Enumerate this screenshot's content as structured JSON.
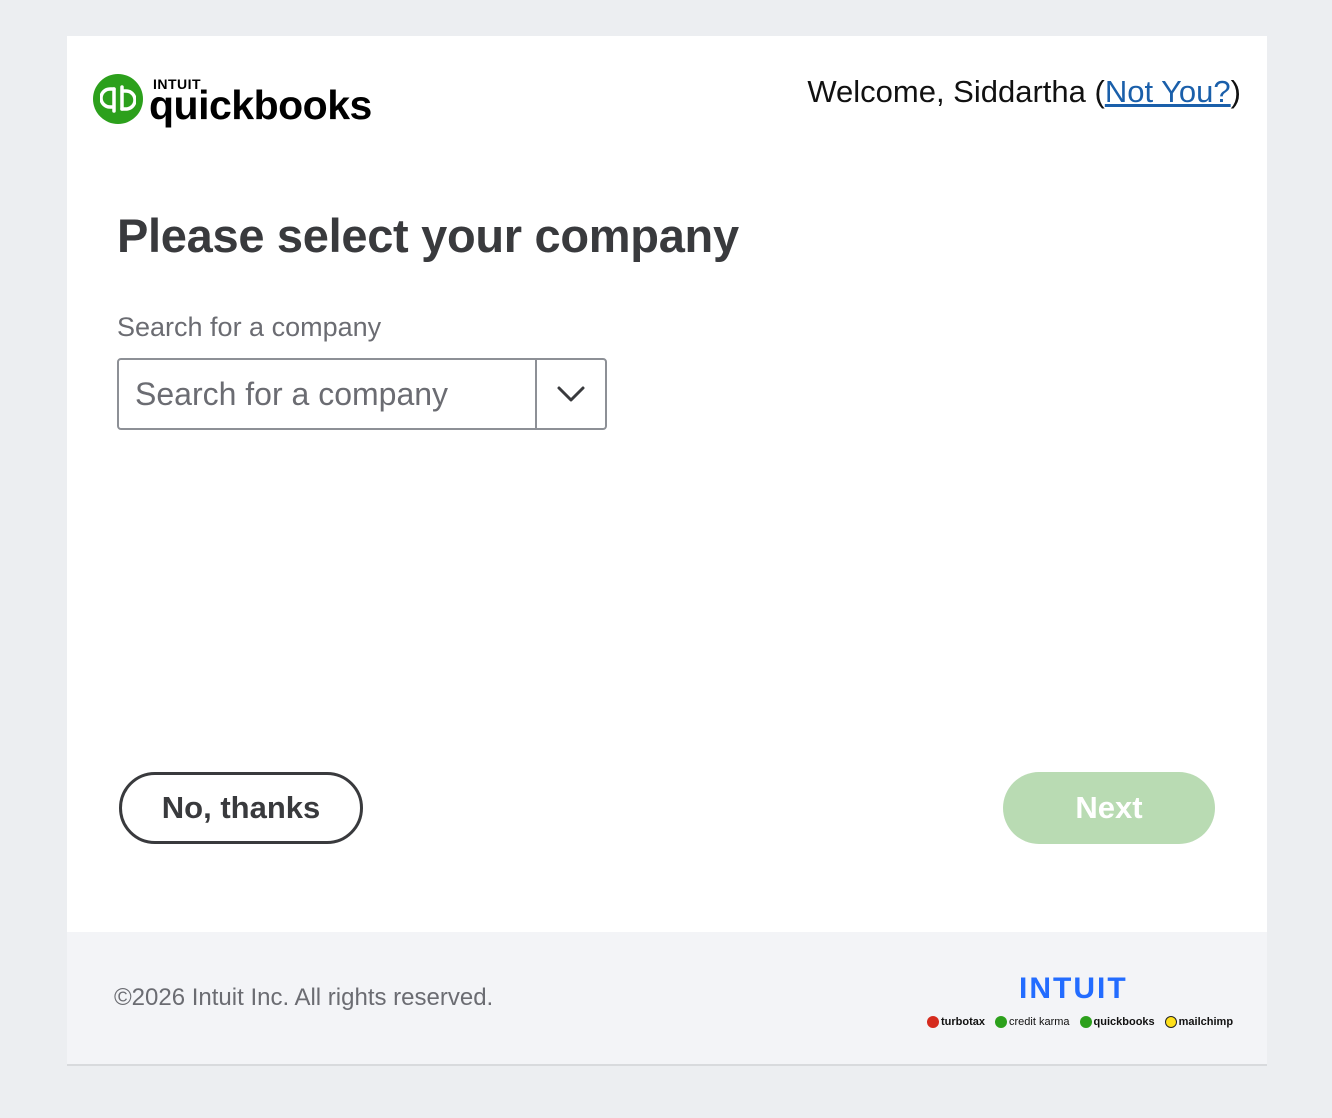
{
  "header": {
    "logo_small": "INTUIT",
    "logo_word": "quickbooks",
    "welcome_prefix": "Welcome, Siddartha (",
    "not_you_link": "Not You?",
    "welcome_suffix": ")"
  },
  "main": {
    "title": "Please select your company",
    "search_label": "Search for a company",
    "search_placeholder": "Search for a company",
    "search_value": ""
  },
  "actions": {
    "cancel_label": "No, thanks",
    "next_label": "Next"
  },
  "footer": {
    "copyright": "©2026 Intuit Inc. All rights reserved.",
    "brand": "INTUIT",
    "family": [
      {
        "label": "turbotax",
        "icon": "turbotax-icon",
        "color": "#d52b1e"
      },
      {
        "label": "credit karma",
        "icon": "credit-karma-icon",
        "color": "#2ca01c"
      },
      {
        "label": "quickbooks",
        "icon": "quickbooks-icon",
        "color": "#2ca01c"
      },
      {
        "label": "mailchimp",
        "icon": "mailchimp-icon",
        "color": "#ffe01b"
      }
    ]
  },
  "colors": {
    "accent_green": "#2ca01c",
    "next_disabled": "#b9dbb3",
    "link_blue": "#1a5faa",
    "intuit_blue": "#236cff"
  }
}
